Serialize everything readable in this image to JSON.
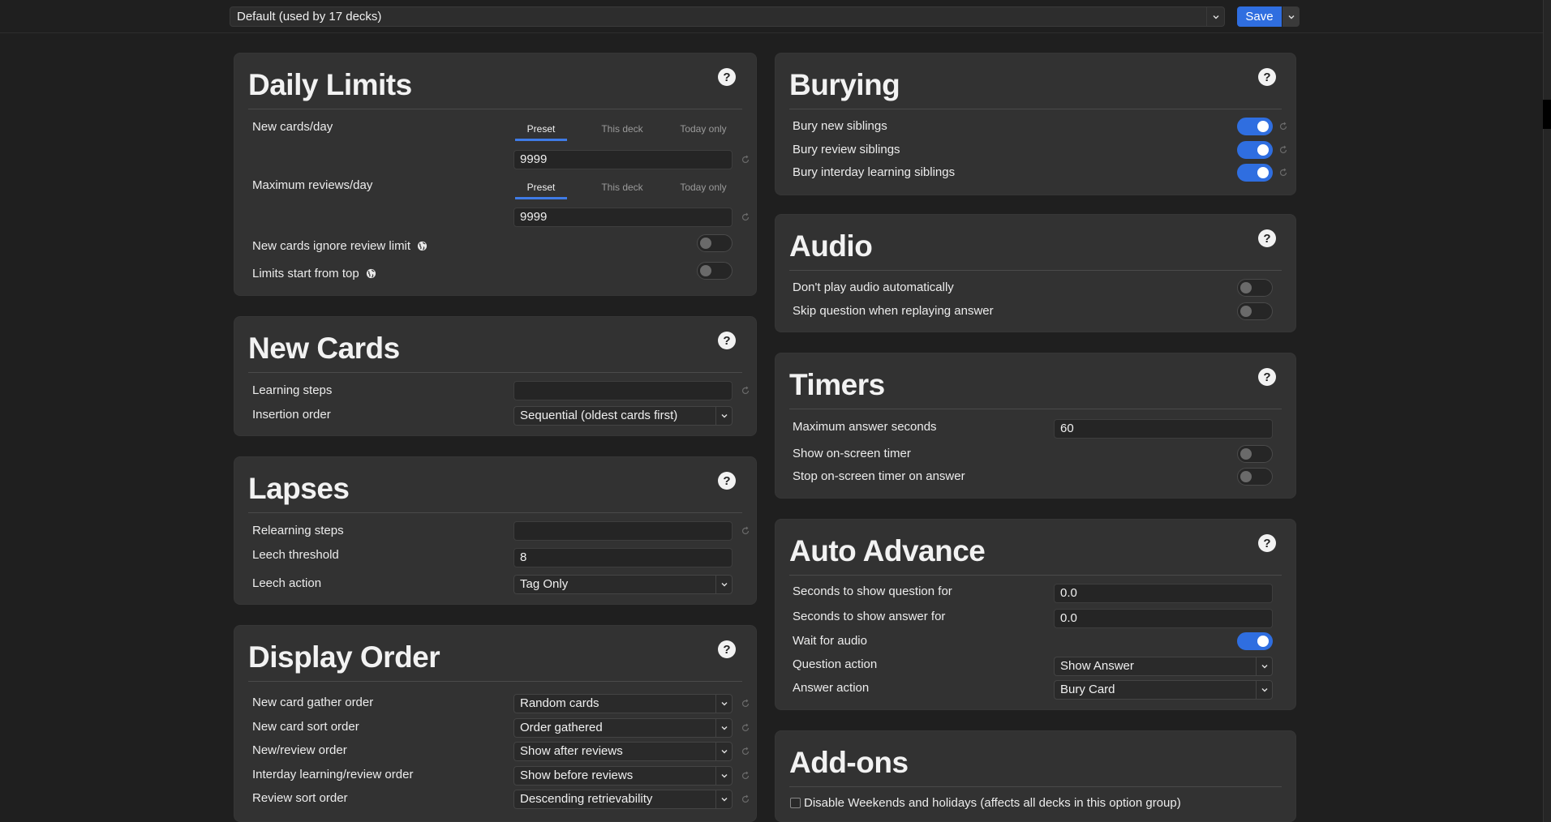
{
  "topbar": {
    "preset": "Default (used by 17 decks)",
    "save_label": "Save"
  },
  "tabs": {
    "preset": "Preset",
    "this_deck": "This deck",
    "today_only": "Today only"
  },
  "help_label": "?",
  "daily_limits": {
    "title": "Daily Limits",
    "new_cards_label": "New cards/day",
    "new_cards_value": "9999",
    "max_reviews_label": "Maximum reviews/day",
    "max_reviews_value": "9999",
    "ignore_review_limit_label": "New cards ignore review limit",
    "ignore_review_limit_on": false,
    "limits_from_top_label": "Limits start from top",
    "limits_from_top_on": false
  },
  "new_cards": {
    "title": "New Cards",
    "learning_steps_label": "Learning steps",
    "learning_steps_value": "",
    "insertion_order_label": "Insertion order",
    "insertion_order_value": "Sequential (oldest cards first)"
  },
  "lapses": {
    "title": "Lapses",
    "relearning_steps_label": "Relearning steps",
    "relearning_steps_value": "",
    "leech_threshold_label": "Leech threshold",
    "leech_threshold_value": "8",
    "leech_action_label": "Leech action",
    "leech_action_value": "Tag Only"
  },
  "display_order": {
    "title": "Display Order",
    "rows": [
      {
        "label": "New card gather order",
        "value": "Random cards"
      },
      {
        "label": "New card sort order",
        "value": "Order gathered"
      },
      {
        "label": "New/review order",
        "value": "Show after reviews"
      },
      {
        "label": "Interday learning/review order",
        "value": "Show before reviews"
      },
      {
        "label": "Review sort order",
        "value": "Descending retrievability"
      }
    ]
  },
  "burying": {
    "title": "Burying",
    "rows": [
      {
        "label": "Bury new siblings",
        "on": true
      },
      {
        "label": "Bury review siblings",
        "on": true
      },
      {
        "label": "Bury interday learning siblings",
        "on": true
      }
    ]
  },
  "audio": {
    "title": "Audio",
    "rows": [
      {
        "label": "Don't play audio automatically",
        "on": false
      },
      {
        "label": "Skip question when replaying answer",
        "on": false
      }
    ]
  },
  "timers": {
    "title": "Timers",
    "max_answer_label": "Maximum answer seconds",
    "max_answer_value": "60",
    "show_timer_label": "Show on-screen timer",
    "stop_timer_label": "Stop on-screen timer on answer"
  },
  "auto_advance": {
    "title": "Auto Advance",
    "question_seconds_label": "Seconds to show question for",
    "question_seconds_value": "0.0",
    "answer_seconds_label": "Seconds to show answer for",
    "answer_seconds_value": "0.0",
    "wait_audio_label": "Wait for audio",
    "question_action_label": "Question action",
    "question_action_value": "Show Answer",
    "answer_action_label": "Answer action",
    "answer_action_value": "Bury Card"
  },
  "addons": {
    "title": "Add-ons",
    "disable_weekends_label": "Disable Weekends and holidays (affects all decks in this option group)"
  },
  "colors": {
    "accent": "#2f6ee0",
    "card": "#323232",
    "background": "#1f1f1f"
  },
  "icons": {
    "help": "question-circle-icon",
    "revert": "revert-arrow-icon",
    "globe": "globe-icon",
    "chevron": "chevron-down-icon"
  }
}
